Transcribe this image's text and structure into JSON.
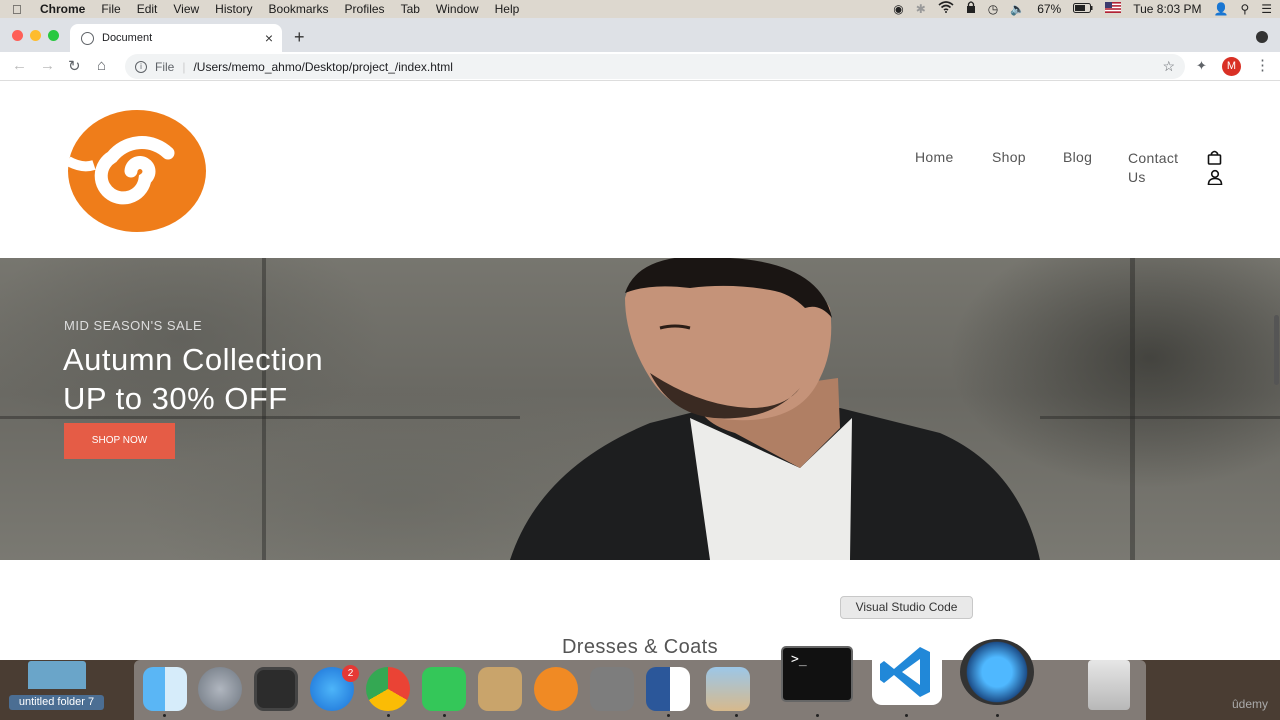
{
  "menubar": {
    "items": [
      "Chrome",
      "File",
      "Edit",
      "View",
      "History",
      "Bookmarks",
      "Profiles",
      "Tab",
      "Window",
      "Help"
    ],
    "battery": "67%",
    "clock": "Tue 8:03 PM"
  },
  "browser": {
    "tab_title": "Document",
    "url_scheme": "File",
    "url": "/Users/memo_ahmo/Desktop/project_/index.html",
    "profile_initial": "M"
  },
  "site": {
    "nav": [
      "Home",
      "Shop",
      "Blog",
      "Contact Us"
    ],
    "hero": {
      "sale_label": "MID SEASON'S SALE",
      "headline_line1": "Autumn Collection",
      "headline_line2": "UP to 30% OFF",
      "button": "SHOP NOW"
    },
    "section_title": "Dresses & Coats"
  },
  "dock": {
    "tooltip": "Visual Studio Code",
    "folder_label": "untitled folder 7",
    "app_store_badge": "2",
    "watermark": "ûdemy",
    "apps": [
      "finder-icon",
      "launchpad-icon",
      "mission-control-icon",
      "app-store-icon",
      "chrome-icon",
      "facetime-icon",
      "contacts-icon",
      "ibooks-icon",
      "system-preferences-icon",
      "word-icon",
      "preview-icon",
      "terminal-icon",
      "vscode-icon",
      "quicktime-icon",
      "trash-icon"
    ]
  },
  "colors": {
    "logo_orange": "#ef7d1a",
    "button_red": "#e55c46",
    "brand_text": "#555555"
  }
}
